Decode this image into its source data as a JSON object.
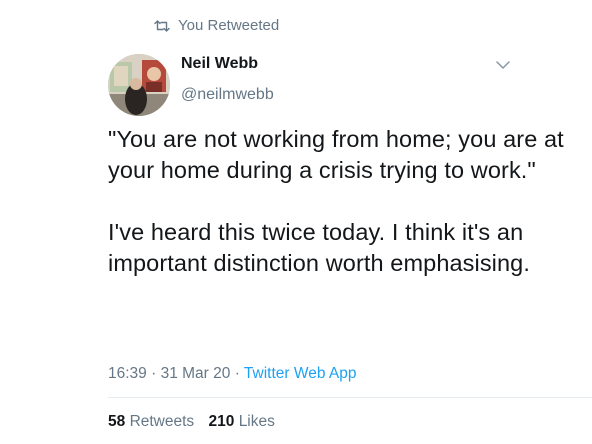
{
  "retweet_context": {
    "label": "You Retweeted"
  },
  "author": {
    "name": "Neil Webb",
    "handle": "@neilmwebb"
  },
  "tweet": {
    "paragraphs": [
      "\"You are not working from home; you are at your home during a crisis trying to work.\"",
      "I've heard this twice today. I think it's an important distinction worth emphasising."
    ],
    "time": "16:39",
    "separator": "·",
    "date": "31 Mar 20",
    "source": "Twitter Web App"
  },
  "stats": {
    "retweets_count": "58",
    "retweets_label": "Retweets",
    "likes_count": "210",
    "likes_label": "Likes"
  },
  "colors": {
    "text": "#14171a",
    "secondary": "#657786",
    "link": "#1da1f2"
  }
}
